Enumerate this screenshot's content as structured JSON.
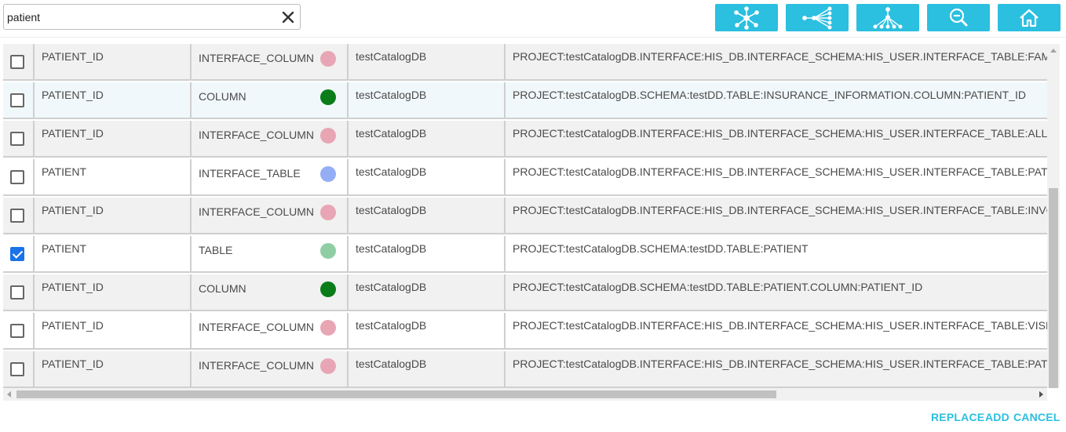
{
  "search": {
    "value": "patient"
  },
  "toolbar": {
    "buttons": [
      {
        "icon": "radial-graph-icon"
      },
      {
        "icon": "horizontal-tree-icon"
      },
      {
        "icon": "vertical-tree-icon"
      },
      {
        "icon": "zoom-out-icon"
      },
      {
        "icon": "home-icon"
      }
    ],
    "accent": "#2bbfe0"
  },
  "rows": [
    {
      "name": "PATIENT_ID",
      "type": "INTERFACE_COLUMN",
      "dot_color": "#e8a6b4",
      "db": "testCatalogDB",
      "path": "PROJECT:testCatalogDB.INTERFACE:HIS_DB.INTERFACE_SCHEMA:HIS_USER.INTERFACE_TABLE:FAM",
      "checked": false
    },
    {
      "name": "PATIENT_ID",
      "type": "COLUMN",
      "dot_color": "#0a7d1a",
      "db": "testCatalogDB",
      "path": "PROJECT:testCatalogDB.SCHEMA:testDD.TABLE:INSURANCE_INFORMATION.COLUMN:PATIENT_ID",
      "checked": false
    },
    {
      "name": "PATIENT_ID",
      "type": "INTERFACE_COLUMN",
      "dot_color": "#e8a6b4",
      "db": "testCatalogDB",
      "path": "PROJECT:testCatalogDB.INTERFACE:HIS_DB.INTERFACE_SCHEMA:HIS_USER.INTERFACE_TABLE:ALLE",
      "checked": false
    },
    {
      "name": "PATIENT",
      "type": "INTERFACE_TABLE",
      "dot_color": "#94aef5",
      "db": "testCatalogDB",
      "path": "PROJECT:testCatalogDB.INTERFACE:HIS_DB.INTERFACE_SCHEMA:HIS_USER.INTERFACE_TABLE:PATI",
      "checked": false
    },
    {
      "name": "PATIENT_ID",
      "type": "INTERFACE_COLUMN",
      "dot_color": "#e8a6b4",
      "db": "testCatalogDB",
      "path": "PROJECT:testCatalogDB.INTERFACE:HIS_DB.INTERFACE_SCHEMA:HIS_USER.INTERFACE_TABLE:INVO",
      "checked": false
    },
    {
      "name": "PATIENT",
      "type": "TABLE",
      "dot_color": "#8fcea4",
      "db": "testCatalogDB",
      "path": "PROJECT:testCatalogDB.SCHEMA:testDD.TABLE:PATIENT",
      "checked": true
    },
    {
      "name": "PATIENT_ID",
      "type": "COLUMN",
      "dot_color": "#0a7d1a",
      "db": "testCatalogDB",
      "path": "PROJECT:testCatalogDB.SCHEMA:testDD.TABLE:PATIENT.COLUMN:PATIENT_ID",
      "checked": false
    },
    {
      "name": "PATIENT_ID",
      "type": "INTERFACE_COLUMN",
      "dot_color": "#e8a6b4",
      "db": "testCatalogDB",
      "path": "PROJECT:testCatalogDB.INTERFACE:HIS_DB.INTERFACE_SCHEMA:HIS_USER.INTERFACE_TABLE:VISIT",
      "checked": false
    },
    {
      "name": "PATIENT_ID",
      "type": "INTERFACE_COLUMN",
      "dot_color": "#e8a6b4",
      "db": "testCatalogDB",
      "path": "PROJECT:testCatalogDB.INTERFACE:HIS_DB.INTERFACE_SCHEMA:HIS_USER.INTERFACE_TABLE:PATI",
      "checked": false
    }
  ],
  "actions": {
    "replace": "REPLACE",
    "add": "ADD",
    "cancel": "CANCEL"
  }
}
